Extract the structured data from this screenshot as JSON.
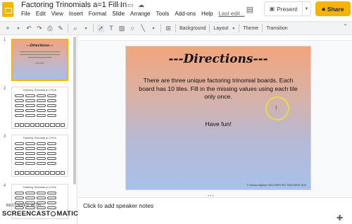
{
  "app": {
    "title": "Factoring Trinomials a=1 Fill In",
    "last_edit": "Last edit...",
    "menu": [
      "File",
      "Edit",
      "View",
      "Insert",
      "Format",
      "Slide",
      "Arrange",
      "Tools",
      "Add-ons",
      "Help"
    ]
  },
  "header": {
    "present_label": "Present",
    "share_label": "Share"
  },
  "toolbar": {
    "labels": {
      "background": "Background",
      "layout": "Layout",
      "theme": "Theme",
      "transition": "Transition"
    }
  },
  "filmstrip": {
    "slides": [
      {
        "number": "1",
        "title": "---Directions---"
      },
      {
        "number": "2",
        "title": "Factoring Trinomials a=1 Fill In"
      },
      {
        "number": "3",
        "title": "Factoring Trinomials a=1 Fill In"
      },
      {
        "number": "4",
        "title": "Factoring Trinomials a=1 Fill In"
      }
    ]
  },
  "slide": {
    "title": "---Directions---",
    "body": "There are three unique factoring trinomial boards. Each board has 10 tiles.  Fill in the missing values using each tile only once.",
    "have_fun": "Have fun!",
    "credit": "© Hansen Algebra  TEACHERS PAY TEACHERS 2020"
  },
  "notes": {
    "placeholder": "Click to add speaker notes"
  },
  "watermark": {
    "top": "RECORDED WITH",
    "main_left": "SCREENCAST",
    "main_right": "MATIC"
  },
  "colors": {
    "accent": "#f4b400",
    "slide_top": "#f3a57d",
    "slide_bottom": "#a8c1ea"
  }
}
